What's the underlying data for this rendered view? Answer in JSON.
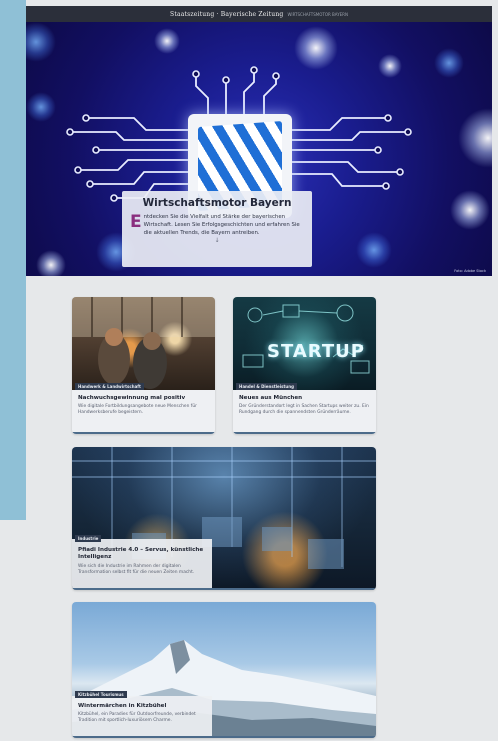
{
  "header": {
    "brand": "Staatszeitung · Bayerische Zeitung",
    "subtitle": "WIRTSCHAFTSMOTOR BAYERN"
  },
  "hero": {
    "title": "Wirtschaftsmotor Bayern",
    "dropcap": "E",
    "intro": "ntdecken Sie die Vielfalt und Stärke der bayerischen Wirtschaft. Lesen Sie Erfolgsgeschichten und erfahren Sie die aktuellen Trends, die Bayern antreiben.",
    "arrow": "↓",
    "credit": "Foto: Adobe Stock"
  },
  "cards": [
    {
      "tag": "Handwerk & Landwirtschaft",
      "title": "Nachwuchsgewinnung mal positiv",
      "desc": "Wie digitale Fortbildungsangebote neue Menschen für Handwerksberufe begeistern."
    },
    {
      "tag": "Handel & Dienstleistung",
      "title": "Neues aus München",
      "desc": "Der Gründerstandort legt in Sachen Startups weiter zu. Ein Rundgang durch die spannendsten Gründerräume.",
      "image_word": "STARTUP"
    },
    {
      "tag": "Industrie",
      "title": "Pfiadi Industrie 4.0 – Servus, künstliche Intelligenz",
      "desc": "Wie sich die Industrie im Rahmen der digitalen Transformation selbst fit für die neuen Zeiten macht."
    },
    {
      "tag": "Kitzbühel Tourismus",
      "title": "Wintermärchen in Kitzbühel",
      "desc": "Kitzbühel, ein Paradies für Outdoorfreunde, verbindet Tradition mit sportlich-luxuriösem Charme."
    }
  ],
  "colors": {
    "hero_blue": "#1a1d8f",
    "accent_magenta": "#8a2e7e",
    "side_strip": "#8fc0d6",
    "tag_bg": "#2e3a4e"
  },
  "icons": [
    "circuit-chip-icon",
    "bavaria-flag-icon",
    "down-arrow-icon"
  ]
}
